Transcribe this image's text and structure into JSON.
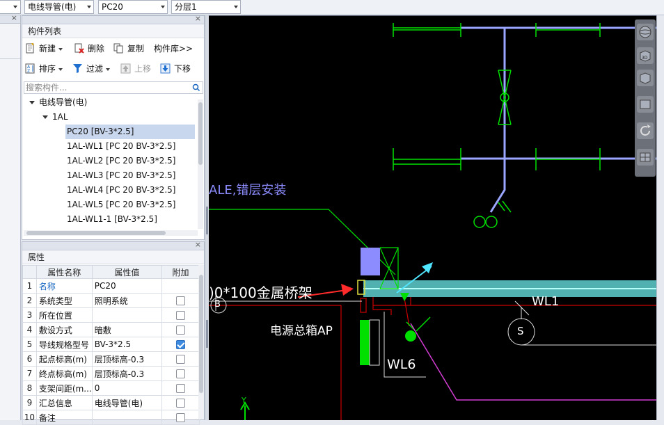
{
  "topbar": {
    "combo1": "电线导管(电)",
    "combo2": "PC20",
    "combo3": "分层1"
  },
  "component_panel": {
    "title": "构件列表",
    "toolbar": {
      "new": "新建",
      "delete": "删除",
      "copy": "复制",
      "library": "构件库>>",
      "sort": "排序",
      "filter": "过滤",
      "move_up": "上移",
      "move_down": "下移"
    },
    "search_placeholder": "搜索构件...",
    "tree": {
      "root": "电线导管(电)",
      "group": "1AL",
      "items": [
        "PC20 [BV-3*2.5]",
        "1AL-WL1 [PC 20 BV-3*2.5]",
        "1AL-WL2 [PC 20 BV-3*2.5]",
        "1AL-WL3 [PC 20 BV-3*2.5]",
        "1AL-WL4 [PC 20 BV-3*2.5]",
        "1AL-WL5 [PC 20 BV-3*2.5]",
        "1AL-WL1-1 [BV-3*2.5]"
      ],
      "selected_index": 0
    }
  },
  "properties_panel": {
    "title": "属性",
    "columns": [
      "属性名称",
      "属性值",
      "附加"
    ],
    "rows": [
      {
        "num": "1",
        "name": "名称",
        "value": "PC20",
        "checkbox": null
      },
      {
        "num": "2",
        "name": "系统类型",
        "value": "照明系统",
        "checkbox": false
      },
      {
        "num": "3",
        "name": "所在位置",
        "value": "",
        "checkbox": false
      },
      {
        "num": "4",
        "name": "敷设方式",
        "value": "暗敷",
        "checkbox": false
      },
      {
        "num": "5",
        "name": "导线规格型号",
        "value": "BV-3*2.5",
        "checkbox": true
      },
      {
        "num": "6",
        "name": "起点标高(m)",
        "value": "层顶标高-0.3",
        "checkbox": false
      },
      {
        "num": "7",
        "name": "终点标高(m)",
        "value": "层顶标高-0.3",
        "checkbox": false
      },
      {
        "num": "8",
        "name": "支架间距(m...",
        "value": "0",
        "checkbox": false
      },
      {
        "num": "9",
        "name": "汇总信息",
        "value": "电线导管(电)",
        "checkbox": false
      },
      {
        "num": "10",
        "name": "备注",
        "value": "",
        "checkbox": false
      }
    ]
  },
  "drawing": {
    "text_ale": "ALE,错层安装",
    "text_tray": ")0*100金属桥架",
    "text_box": "电源总箱AP",
    "text_wl6": "WL6",
    "text_wl1": "WL1",
    "text_b": "B",
    "text_s": "S",
    "text_y": "Y",
    "nav_3d": "3D"
  },
  "colors": {
    "canvas_bg": "#000000",
    "cad_green": "#00e000",
    "cad_blue_line": "#9aa6ff",
    "tray_cyan": "#7fe6e6",
    "cad_red": "#cc0000",
    "cad_magenta": "#d23cd2",
    "selected_row": "#c9d7ee",
    "checkbox_checked": "#3d8be0"
  }
}
